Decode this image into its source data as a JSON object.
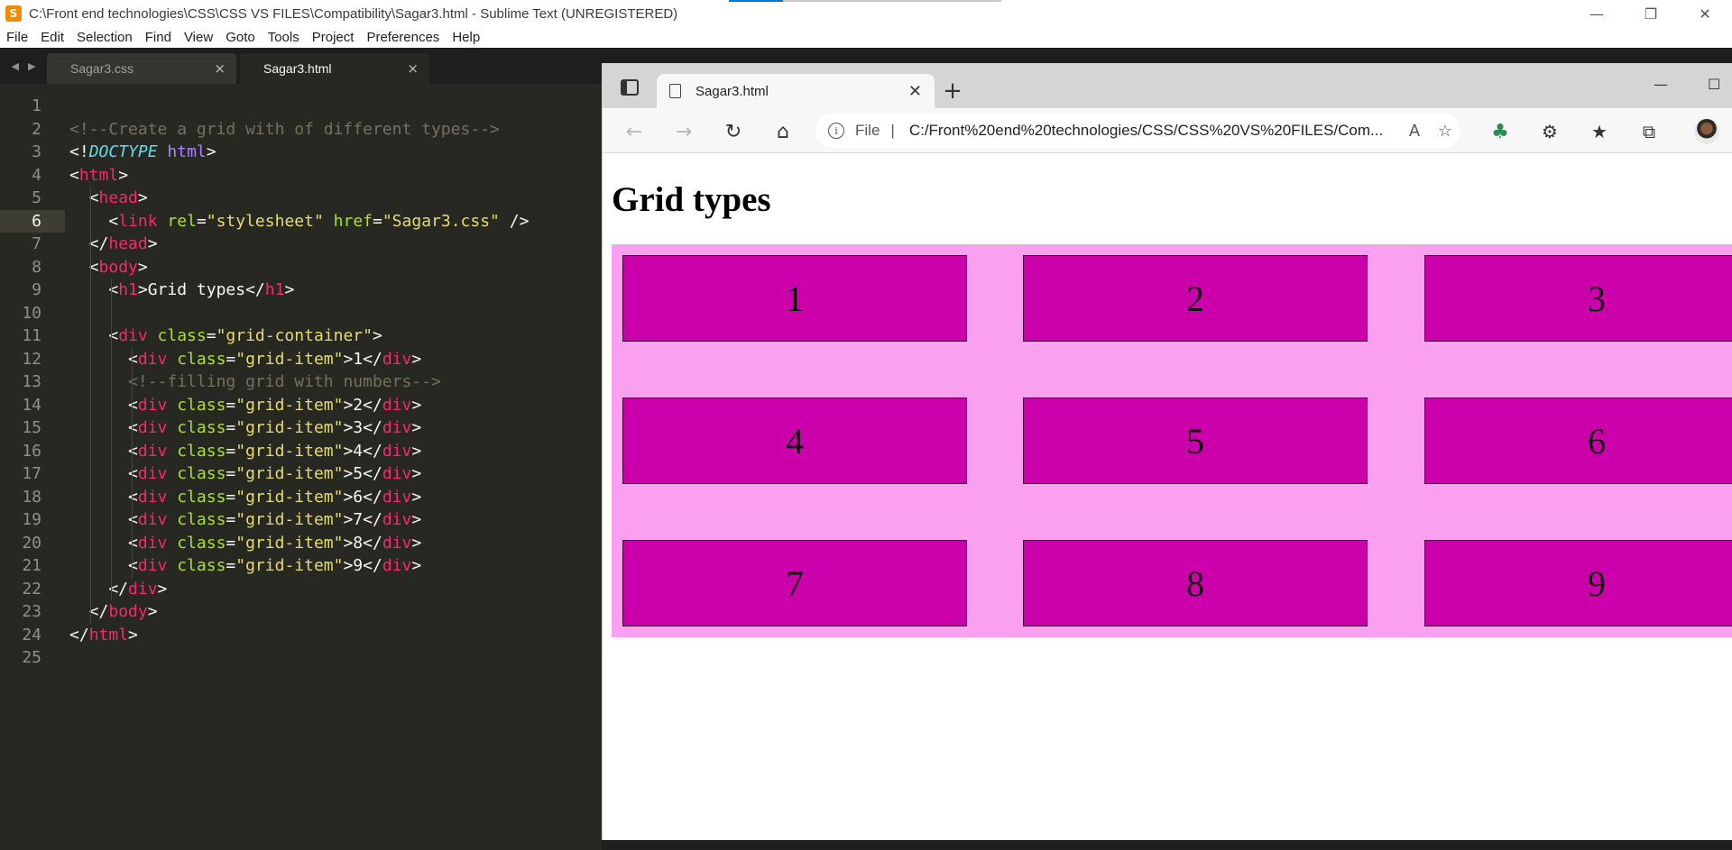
{
  "window": {
    "title": "C:\\Front end technologies\\CSS\\CSS VS FILES\\Compatibility\\Sagar3.html - Sublime Text (UNREGISTERED)",
    "app_icon_letter": "S",
    "minimize": "—",
    "maximize": "❐",
    "close": "✕"
  },
  "menu": [
    "File",
    "Edit",
    "Selection",
    "Find",
    "View",
    "Goto",
    "Tools",
    "Project",
    "Preferences",
    "Help"
  ],
  "editor": {
    "tabs": [
      {
        "label": "Sagar3.css",
        "close": "×"
      },
      {
        "label": "Sagar3.html",
        "close": "×"
      }
    ],
    "current_line": "6",
    "lines": [
      {
        "n": "1",
        "html": ""
      },
      {
        "n": "2",
        "html": "<span class=\"c-com\">&lt;!--Create a grid with of different types--&gt;</span>"
      },
      {
        "n": "3",
        "html": "&lt;!<span class=\"c-dt\">DOCTYPE</span> <span class=\"c-kw\">html</span>&gt;"
      },
      {
        "n": "4",
        "html": "&lt;<span class=\"c-tag\">html</span>&gt;"
      },
      {
        "n": "5",
        "html": "  &lt;<span class=\"c-tag\">head</span>&gt;"
      },
      {
        "n": "6",
        "html": "    &lt;<span class=\"c-tag\">link</span> <span class=\"c-attr\">rel</span>=<span class=\"c-str\">\"stylesheet\"</span> <span class=\"c-attr\">href</span>=<span class=\"c-str\">\"Sagar3.css\"</span> /&gt;"
      },
      {
        "n": "7",
        "html": "  &lt;/<span class=\"c-tag\">head</span>&gt;"
      },
      {
        "n": "8",
        "html": "  &lt;<span class=\"c-tag\">body</span>&gt;"
      },
      {
        "n": "9",
        "html": "    &lt;<span class=\"c-tag\">h1</span>&gt;Grid types&lt;/<span class=\"c-tag\">h1</span>&gt;"
      },
      {
        "n": "10",
        "html": ""
      },
      {
        "n": "11",
        "html": "    &lt;<span class=\"c-tag\">div</span> <span class=\"c-attr\">class</span>=<span class=\"c-str\">\"grid-container\"</span>&gt;"
      },
      {
        "n": "12",
        "html": "      &lt;<span class=\"c-tag\">div</span> <span class=\"c-attr\">class</span>=<span class=\"c-str\">\"grid-item\"</span>&gt;1&lt;/<span class=\"c-tag\">div</span>&gt;"
      },
      {
        "n": "13",
        "html": "      <span class=\"c-com\">&lt;!--filling grid with numbers--&gt;</span>"
      },
      {
        "n": "14",
        "html": "      &lt;<span class=\"c-tag\">div</span> <span class=\"c-attr\">class</span>=<span class=\"c-str\">\"grid-item\"</span>&gt;2&lt;/<span class=\"c-tag\">div</span>&gt;"
      },
      {
        "n": "15",
        "html": "      &lt;<span class=\"c-tag\">div</span> <span class=\"c-attr\">class</span>=<span class=\"c-str\">\"grid-item\"</span>&gt;3&lt;/<span class=\"c-tag\">div</span>&gt;"
      },
      {
        "n": "16",
        "html": "      &lt;<span class=\"c-tag\">div</span> <span class=\"c-attr\">class</span>=<span class=\"c-str\">\"grid-item\"</span>&gt;4&lt;/<span class=\"c-tag\">div</span>&gt;"
      },
      {
        "n": "17",
        "html": "      &lt;<span class=\"c-tag\">div</span> <span class=\"c-attr\">class</span>=<span class=\"c-str\">\"grid-item\"</span>&gt;5&lt;/<span class=\"c-tag\">div</span>&gt;"
      },
      {
        "n": "18",
        "html": "      &lt;<span class=\"c-tag\">div</span> <span class=\"c-attr\">class</span>=<span class=\"c-str\">\"grid-item\"</span>&gt;6&lt;/<span class=\"c-tag\">div</span>&gt;"
      },
      {
        "n": "19",
        "html": "      &lt;<span class=\"c-tag\">div</span> <span class=\"c-attr\">class</span>=<span class=\"c-str\">\"grid-item\"</span>&gt;7&lt;/<span class=\"c-tag\">div</span>&gt;"
      },
      {
        "n": "20",
        "html": "      &lt;<span class=\"c-tag\">div</span> <span class=\"c-attr\">class</span>=<span class=\"c-str\">\"grid-item\"</span>&gt;8&lt;/<span class=\"c-tag\">div</span>&gt;"
      },
      {
        "n": "21",
        "html": "      &lt;<span class=\"c-tag\">div</span> <span class=\"c-attr\">class</span>=<span class=\"c-str\">\"grid-item\"</span>&gt;9&lt;/<span class=\"c-tag\">div</span>&gt;"
      },
      {
        "n": "22",
        "html": "    &lt;/<span class=\"c-tag\">div</span>&gt;"
      },
      {
        "n": "23",
        "html": "  &lt;/<span class=\"c-tag\">body</span>&gt;"
      },
      {
        "n": "24",
        "html": "&lt;/<span class=\"c-tag\">html</span>&gt;"
      },
      {
        "n": "25",
        "html": ""
      }
    ]
  },
  "browser": {
    "tab_title": "Sagar3.html",
    "tab_close": "✕",
    "new_tab": "+",
    "minimize": "—",
    "maximize": "☐",
    "back": "←",
    "forward": "→",
    "reload": "↻",
    "home": "⌂",
    "info": "i",
    "file_label": "File",
    "separator": "|",
    "url": "C:/Front%20end%20technologies/CSS/CSS%20VS%20FILES/Com...",
    "read_aloud": "A",
    "favorite_add": "☆",
    "extensions": "⚙",
    "favorites": "★",
    "collections": "⧉",
    "page": {
      "heading": "Grid types",
      "items": [
        "1",
        "2",
        "3",
        "4",
        "5",
        "6",
        "7",
        "8",
        "9"
      ]
    }
  },
  "colors": {
    "grid_container": "#f9a0f0",
    "grid_item": "#cc00aa",
    "editor_bg": "#272822"
  }
}
